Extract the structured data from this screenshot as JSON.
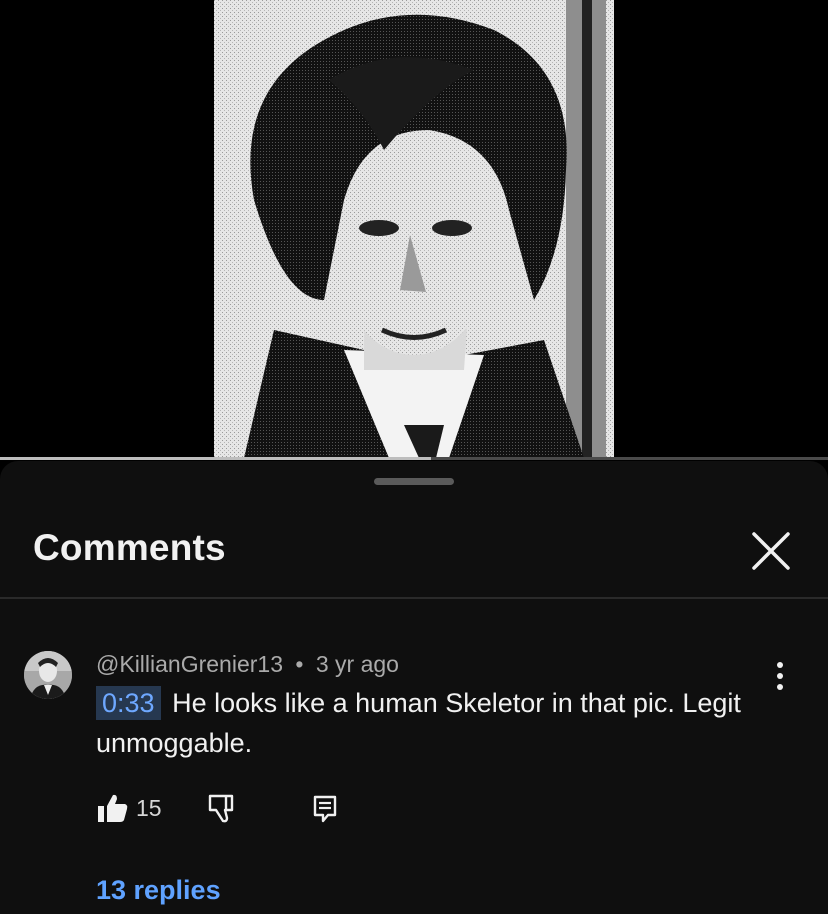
{
  "video": {
    "image": "black-and-white-newspaper-portrait",
    "progress_fraction": 0.52
  },
  "comments_sheet": {
    "title": "Comments",
    "close_icon": "close-icon",
    "comment": {
      "author": "@KillianGrenier13",
      "separator": "•",
      "age": "3 yr ago",
      "timestamp": "0:33",
      "text": "He looks like a human Skeletor in that pic. Legit unmoggable.",
      "likes": "15",
      "replies_label": "13 replies",
      "icons": {
        "like": "thumbs-up-icon",
        "dislike": "thumbs-down-icon",
        "reply": "reply-icon",
        "more": "more-vertical-icon"
      }
    }
  },
  "colors": {
    "sheet_bg": "#0f0f0f",
    "link_blue": "#5fa2ff",
    "timestamp_bg": "#263850",
    "secondary_text": "#aaaaaa"
  }
}
